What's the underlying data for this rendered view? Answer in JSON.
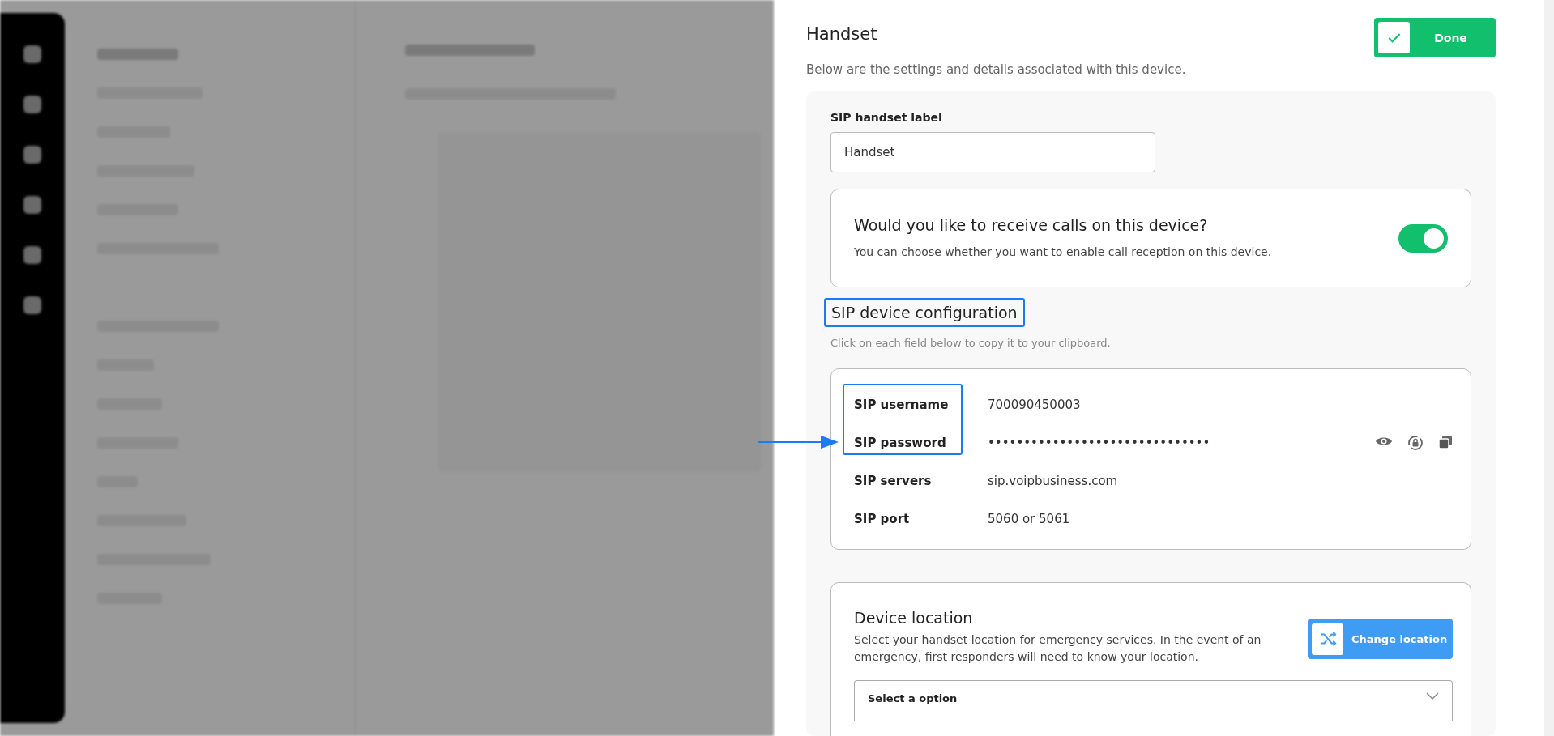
{
  "panel": {
    "title": "Handset",
    "done_button": "Done",
    "subtitle": "Below are the settings and details associated with this device."
  },
  "label_field": {
    "label": "SIP handset label",
    "value": "Handset"
  },
  "call_reception": {
    "title": "Would you like to receive calls on this device?",
    "description": "You can choose whether you want to enable call reception on this device.",
    "on": true
  },
  "sip_config": {
    "title": "SIP device configuration",
    "hint": "Click on each field below to copy it to your clipboard.",
    "rows": [
      {
        "kind": "plain",
        "label": "SIP username",
        "value": "700090450003"
      },
      {
        "kind": "secret",
        "label": "SIP password",
        "value": "•••••••••••••••••••••••••••••••"
      },
      {
        "kind": "plain",
        "label": "SIP servers",
        "value": "sip.voipbusiness.com"
      },
      {
        "kind": "plain",
        "label": "SIP port",
        "value": "5060 or 5061"
      }
    ]
  },
  "device_location": {
    "title": "Device location",
    "description": "Select your handset location for emergency services. In the event of an emergency, first responders will need to know your location.",
    "button": "Change location",
    "select_placeholder": "Select a option"
  }
}
